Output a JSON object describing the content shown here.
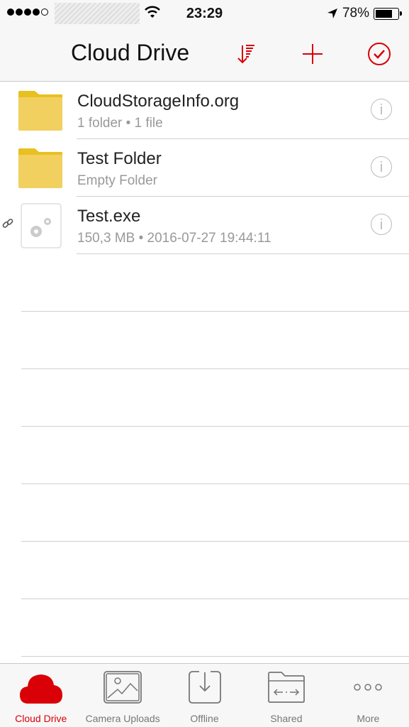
{
  "status_bar": {
    "time": "23:29",
    "battery": "78%",
    "battery_level": 0.78
  },
  "header": {
    "title": "Cloud Drive"
  },
  "colors": {
    "accent": "#d90007",
    "folder": "#f1d060"
  },
  "files": [
    {
      "name": "CloudStorageInfo.org",
      "detail": "1 folder • 1 file",
      "type": "folder",
      "linked": false
    },
    {
      "name": "Test Folder",
      "detail": "Empty Folder",
      "type": "folder",
      "linked": false
    },
    {
      "name": "Test.exe",
      "detail": "150,3 MB • 2016-07-27 19:44:11",
      "type": "executable",
      "linked": true
    }
  ],
  "info_glyph": "i",
  "tabs": [
    {
      "label": "Cloud Drive",
      "icon": "cloud-icon",
      "active": true
    },
    {
      "label": "Camera Uploads",
      "icon": "image-icon",
      "active": false
    },
    {
      "label": "Offline",
      "icon": "download-icon",
      "active": false
    },
    {
      "label": "Shared",
      "icon": "shared-folder-icon",
      "active": false
    },
    {
      "label": "More",
      "icon": "more-icon",
      "active": false
    }
  ]
}
